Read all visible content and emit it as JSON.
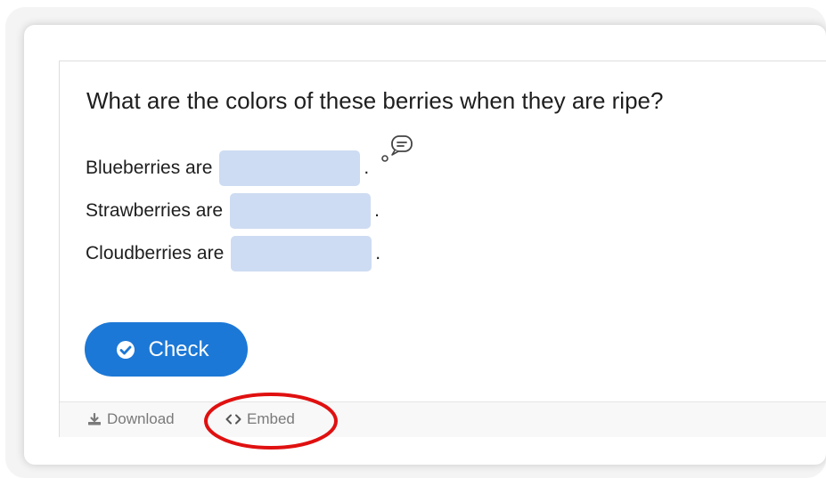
{
  "question": {
    "text": "What are the colors of these berries when they are ripe?"
  },
  "blanks": [
    {
      "label": "Blueberries are",
      "value": "",
      "period": "."
    },
    {
      "label": "Strawberries are",
      "value": "",
      "period": "."
    },
    {
      "label": "Cloudberries are",
      "value": "",
      "period": "."
    }
  ],
  "check_button": {
    "label": "Check",
    "icon": "check-circle-icon"
  },
  "footer": {
    "download_label": "Download",
    "download_icon": "download-icon",
    "embed_label": "Embed",
    "embed_icon": "code-brackets-icon"
  },
  "tip_icon": "speech-bubble-icon",
  "colors": {
    "accent": "#1c78d6",
    "blank_fill": "#cddcf2",
    "highlight": "#e01010"
  }
}
